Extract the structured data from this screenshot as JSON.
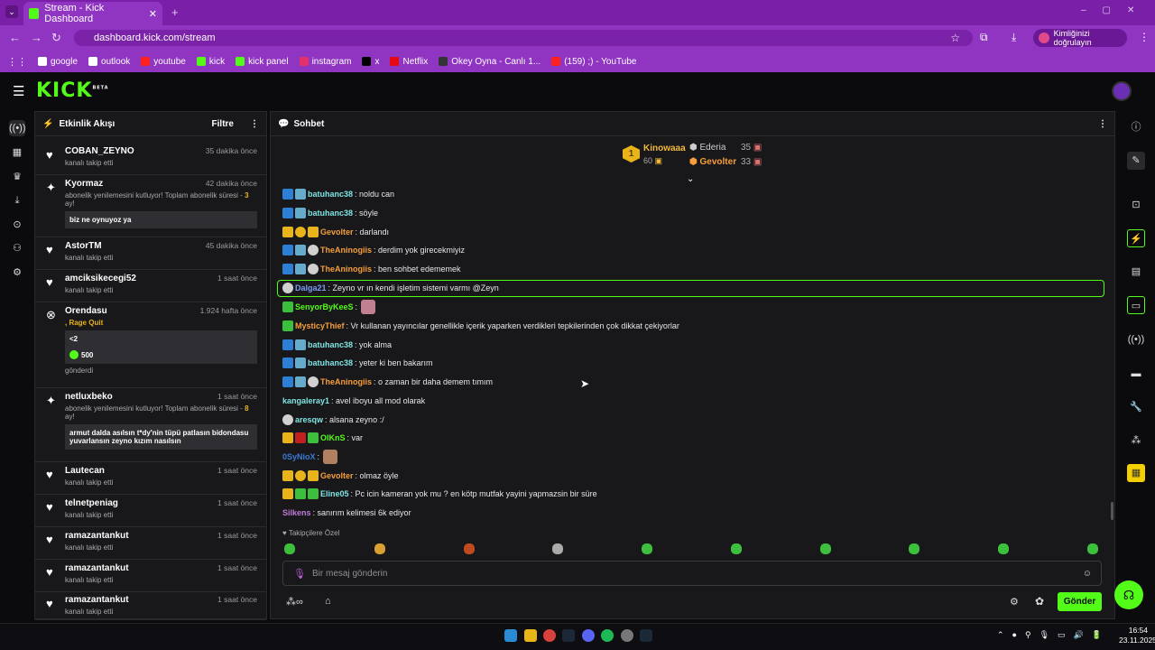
{
  "browser": {
    "tab_title": "Stream - Kick Dashboard",
    "url": "dashboard.kick.com/stream",
    "verify_label": "Kimliğinizi doğrulayın",
    "bookmarks": [
      {
        "label": "google",
        "color": "#ffffff"
      },
      {
        "label": "outlook",
        "color": "#ffffff"
      },
      {
        "label": "youtube",
        "color": "#ff2020"
      },
      {
        "label": "kick",
        "color": "#53fc18"
      },
      {
        "label": "kick panel",
        "color": "#53fc18"
      },
      {
        "label": "instagram",
        "color": "#e1306c"
      },
      {
        "label": "x",
        "color": "#000000"
      },
      {
        "label": "Netflix",
        "color": "#e50914"
      },
      {
        "label": "Okey Oyna - Canlı 1...",
        "color": "#333333"
      },
      {
        "label": "(159) ;) - YouTube",
        "color": "#ff2020"
      }
    ]
  },
  "header": {
    "logo": "KICK",
    "logo_tag": "BETA"
  },
  "activity": {
    "title": "Etkinlik Akışı",
    "filter": "Filtre",
    "events": [
      {
        "name": "COBAN_ZEYNO",
        "time": "35 dakika önce",
        "sub": "kanalı takip etti"
      },
      {
        "name": "Kyormaz",
        "time": "42 dakika önce",
        "sub": "abonelik yenilemesini kutluyor! Toplam abonelik süresi -",
        "months": "3",
        "months_suffix": " ay!",
        "message": "biz ne oynuyoz ya"
      },
      {
        "name": "AstorTM",
        "time": "45 dakika önce",
        "sub": "kanalı takip etti"
      },
      {
        "name": "amciksikecegi52",
        "time": "1 saat önce",
        "sub": "kanalı takip etti"
      },
      {
        "name": "Orendasu",
        "time": "1.924 hafta önce",
        "sub": ", Rage Quit",
        "message": "<2",
        "amount": "500",
        "sent": "gönderdi"
      },
      {
        "name": "netluxbeko",
        "time": "1 saat önce",
        "sub": "abonelik yenilemesini kutluyor! Toplam abonelik süresi -",
        "months": "8",
        "months_suffix": " ay!",
        "message": "armut dalda asılsın t*dy'nin tüpü patlasın bidondasu yuvarlansın zeyno kızım nasılsın"
      },
      {
        "name": "Lautecan",
        "time": "1 saat önce",
        "sub": "kanalı takip etti"
      },
      {
        "name": "telnetpeniag",
        "time": "1 saat önce",
        "sub": "kanalı takip etti"
      },
      {
        "name": "ramazantankut",
        "time": "1 saat önce",
        "sub": "kanalı takip etti"
      },
      {
        "name": "ramazantankut",
        "time": "1 saat önce",
        "sub": "kanalı takip etti"
      },
      {
        "name": "ramazantankut",
        "time": "1 saat önce",
        "sub": "kanalı takip etti"
      }
    ]
  },
  "chat": {
    "title": "Sohbet",
    "leaderboard": {
      "first_name": "Kinowaaa",
      "first_value": "60",
      "first_rank": "1",
      "second_name": "Ederia",
      "second_value": "35",
      "third_name": "Gevolter",
      "third_value": "33"
    },
    "messages": [
      {
        "user": "batuhanc38",
        "text": ": noldu can",
        "color": "c-cyan",
        "badges": [
          "b-mod",
          "b-sub"
        ]
      },
      {
        "user": "batuhanc38",
        "text": ": söyle",
        "color": "c-cyan",
        "badges": [
          "b-mod",
          "b-sub"
        ]
      },
      {
        "user": "Gevolter",
        "text": ": darlandı",
        "color": "c-orange",
        "badges": [
          "b-crown",
          "b-gift",
          "b-crown"
        ]
      },
      {
        "user": "TheAninogiis",
        "text": ": derdim yok girecekmiyiz",
        "color": "c-orange",
        "badges": [
          "b-mod",
          "b-sub",
          "b-ava"
        ]
      },
      {
        "user": "TheAninogiis",
        "text": ": ben sohbet edememek",
        "color": "c-orange",
        "badges": [
          "b-mod",
          "b-sub",
          "b-ava"
        ]
      },
      {
        "user": "Dalga21",
        "text": ": Zeyno vr ın kendi işletim sistemi varmı @Zeyn",
        "color": "c-lblue",
        "badges": [
          "b-ava"
        ]
      },
      {
        "user": "SenyorByKeeS",
        "text": ":",
        "color": "c-green",
        "badges": [
          "b-green"
        ]
      },
      {
        "user": "MysticyThief",
        "text": ": Vr kullanan yayıncılar genellikle içerik yaparken verdikleri tepkilerinden çok dikkat çekiyorlar",
        "color": "c-orange",
        "badges": [
          "b-green"
        ]
      },
      {
        "user": "batuhanc38",
        "text": ": yok alma",
        "color": "c-cyan",
        "badges": [
          "b-mod",
          "b-sub"
        ]
      },
      {
        "user": "batuhanc38",
        "text": ": yeter ki ben bakarım",
        "color": "c-cyan",
        "badges": [
          "b-mod",
          "b-sub"
        ]
      },
      {
        "user": "TheAninogiis",
        "text": ": o zaman bir daha demem tımım",
        "color": "c-orange",
        "badges": [
          "b-mod",
          "b-sub",
          "b-ava"
        ]
      },
      {
        "user": "kangaleray1",
        "text": ": avel iboyu all mod olarak",
        "color": "c-cyan",
        "badges": []
      },
      {
        "user": "aresqw",
        "text": ": alsana zeyno :/",
        "color": "c-cyan",
        "badges": [
          "b-ava"
        ]
      },
      {
        "user": "OlKnS",
        "text": ": var",
        "color": "c-green",
        "badges": [
          "b-crown",
          "b-red",
          "b-green"
        ]
      },
      {
        "user": "0SyNioX",
        "text": ":",
        "color": "c-tblue",
        "badges": []
      },
      {
        "user": "Gevolter",
        "text": ": olmaz öyle",
        "color": "c-orange",
        "badges": [
          "b-crown",
          "b-gift",
          "b-crown"
        ]
      },
      {
        "user": "Eline05",
        "text": ": Pc icin kameran yok mu ? en kötp mutfak yayini yapmazsin bir süre",
        "color": "c-cyan",
        "badges": [
          "b-crown",
          "b-green",
          "b-green"
        ]
      },
      {
        "user": "Silkens",
        "text": ": sanırım kelimesi 6k ediyor",
        "color": "c-pink",
        "badges": []
      }
    ],
    "emote_section": "Takipçilere Özel",
    "input_placeholder": "Bir mesaj gönderin",
    "send_label": "Gönder"
  },
  "taskbar": {
    "time": "16:54",
    "date": "23.11.2025"
  }
}
